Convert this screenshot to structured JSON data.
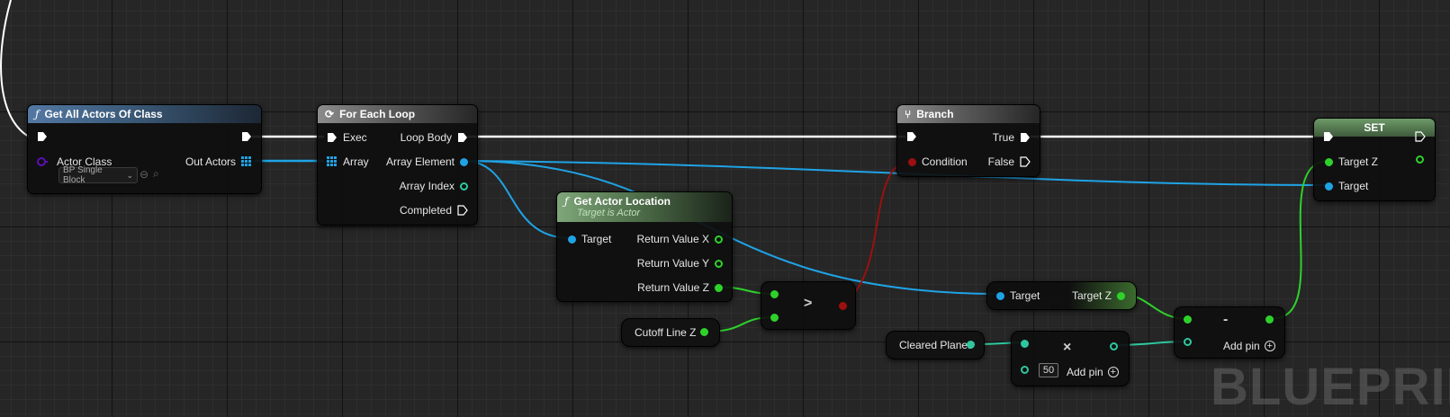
{
  "colors": {
    "exec": "#ffffff",
    "object": "#1fa3e5",
    "float": "#2ed12b",
    "bool": "#9c1010",
    "class": "#5b0fb5",
    "int": "#2fc7a0",
    "array_object": "#1fa3e5"
  },
  "nodes": {
    "get_all_actors": {
      "title": "Get All Actors Of Class",
      "icon": "function-icon",
      "actor_class_label": "Actor Class",
      "actor_class_value": "BP Single Block",
      "out_actors_label": "Out Actors"
    },
    "for_each_loop": {
      "title": "For Each Loop",
      "icon": "loop-icon",
      "exec_label": "Exec",
      "array_label": "Array",
      "loop_body_label": "Loop Body",
      "array_element_label": "Array Element",
      "array_index_label": "Array Index",
      "completed_label": "Completed"
    },
    "get_actor_location": {
      "title": "Get Actor Location",
      "subtitle": "Target is Actor",
      "target_label": "Target",
      "return_x": "Return Value X",
      "return_y": "Return Value Y",
      "return_z": "Return Value Z"
    },
    "branch": {
      "title": "Branch",
      "icon": "branch-icon",
      "condition_label": "Condition",
      "true_label": "True",
      "false_label": "False"
    },
    "set_node": {
      "title": "SET",
      "target_z_label": "Target Z",
      "target_label": "Target"
    },
    "greater_than": {
      "symbol": ">"
    },
    "cutoff_line_z": {
      "label": "Cutoff Line Z"
    },
    "target_z_getter": {
      "target_label": "Target",
      "output_label": "Target Z"
    },
    "cleared_planes": {
      "label": "Cleared Planes"
    },
    "multiply": {
      "symbol": "×",
      "constant": "50",
      "add_pin": "Add pin"
    },
    "subtract": {
      "symbol": "-",
      "add_pin": "Add pin"
    }
  },
  "watermark": "BLUEPRINT"
}
